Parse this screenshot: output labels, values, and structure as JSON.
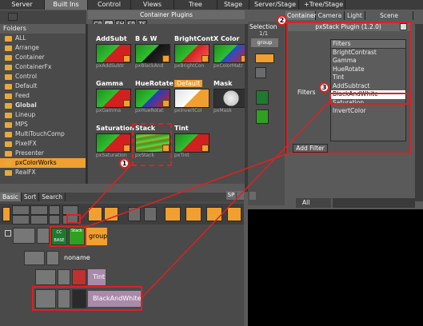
{
  "top_tabs": [
    "Server",
    "Built Ins",
    "Control",
    "Views",
    "Tree",
    "Stage",
    "Server/Stage",
    "+Tree/Stage"
  ],
  "active_top_tab": "Built Ins",
  "plugin_category": "Container Plugins",
  "sub_tabs": [
    "GP",
    "CP",
    "SH",
    "SP",
    "TS"
  ],
  "folders_header": "Folders",
  "folders": [
    "ALL",
    "Arrange",
    "Container",
    "ContainerFx",
    "Control",
    "Default",
    "Feed",
    "Global",
    "Lineup",
    "MPS",
    "MultiTouchComp",
    "PixelFX",
    "Presenter",
    "pxColorWorks",
    "RealFX"
  ],
  "selected_folder": "pxColorWorks",
  "plugins": [
    {
      "name": "AddSubt",
      "sub": "pxAddSubtr"
    },
    {
      "name": "B & W",
      "sub": "pxBlackAnd"
    },
    {
      "name": "BrightCont",
      "sub": "pxBrightCon"
    },
    {
      "name": "X Color",
      "sub": "pxColorMatr"
    },
    {
      "name": "Gamma",
      "sub": "pxGamma"
    },
    {
      "name": "HueRotate",
      "sub": "pxHueRotat"
    },
    {
      "name": "Default",
      "sub": "pxInvertCol"
    },
    {
      "name": "Mask",
      "sub": "pxMask"
    },
    {
      "name": "Saturation",
      "sub": "pxSaturation"
    },
    {
      "name": "Stack",
      "sub": "pxStack"
    },
    {
      "name": "Tint",
      "sub": "pxTint"
    }
  ],
  "right_tabs": [
    "Container",
    "Camera",
    "Light",
    "Scene Settings"
  ],
  "selection_label": "Selection",
  "selection_count": "1/1",
  "selection_item": "group",
  "dialog_title": "pxStack Plugin (1.2.0)",
  "filters_label": "Filters",
  "filters_header": "Filters",
  "filters": [
    "BrightContrast",
    "Gamma",
    "HueRotate",
    "Tint",
    "AddSubtract",
    "BlackAndWhite",
    "Saturation",
    "InvertColor"
  ],
  "selected_filter": "BlackAndWhite",
  "add_filter_label": "Add Filter",
  "bottom_tabs": [
    "Basic",
    "Sort",
    "Search"
  ],
  "sp_label": "SP",
  "all_label": "All",
  "tree_nodes": [
    "group",
    "noname",
    "Tint",
    "BlackAndWhite"
  ],
  "cc_base_label": "CC BASE",
  "stack_mini_label": "Stack",
  "callouts": [
    "1",
    "2",
    "3"
  ],
  "colors": {
    "accent_orange": "#f0a030",
    "highlight_red": "#e02020",
    "node_purple": "#a98aaa"
  }
}
